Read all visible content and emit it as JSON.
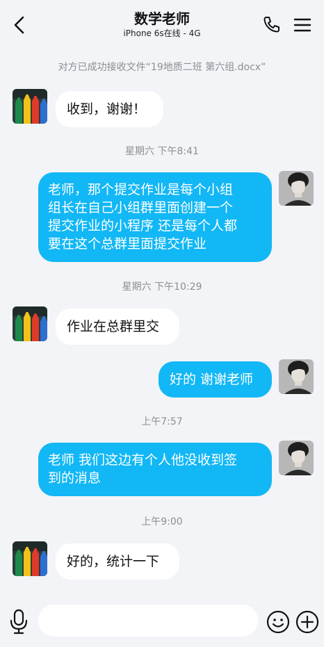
{
  "header": {
    "title": "数学老师",
    "subtitle": "iPhone 6s在线 - 4G"
  },
  "system_messages": {
    "file_notice": "对方已成功接收文件“19地质二班  第六组.docx”",
    "time1": "星期六 下午8:41",
    "time2": "星期六 下午10:29",
    "time3": "上午7:57",
    "time4": "上午9:00"
  },
  "messages": [
    {
      "side": "in",
      "text": "收到，谢谢！"
    },
    {
      "side": "out",
      "lines": [
        "老师，那个提交作业是每个小组",
        "组长在自己小组群里面创建一个",
        "提交作业的小程序 还是每个人都",
        "要在这个总群里面提交作业"
      ]
    },
    {
      "side": "in",
      "text": "作业在总群里交"
    },
    {
      "side": "out",
      "text": "好的 谢谢老师"
    },
    {
      "side": "out",
      "lines": [
        "老师 我们这边有个人他没收到签",
        "到的消息"
      ]
    },
    {
      "side": "in",
      "text": "好的，统计一下"
    }
  ],
  "input": {
    "value": ""
  },
  "icons": {
    "back": "chevron-left-icon",
    "phone": "phone-icon",
    "menu": "hamburger-menu-icon",
    "mic": "microphone-icon",
    "emoji": "smiley-icon",
    "plus": "plus-circle-icon"
  },
  "colors": {
    "background": "#f2f4f7",
    "outgoing_bubble": "#12b7f5",
    "incoming_bubble": "#ffffff",
    "timestamp": "#8e8e93"
  }
}
